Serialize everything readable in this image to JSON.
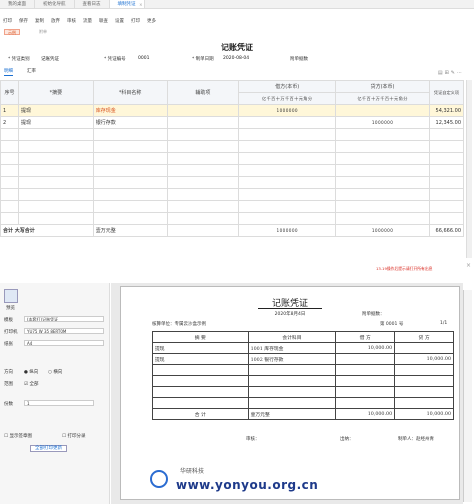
{
  "tabs": [
    {
      "label": "我的桌面"
    },
    {
      "label": "初始化导航"
    },
    {
      "label": "查看日志"
    },
    {
      "label": "填制凭证",
      "active": true
    }
  ],
  "toolbar": [
    "打印",
    "保存",
    "复制",
    "放弃",
    "",
    "审核",
    "流量",
    "联查",
    "设置",
    "打印",
    "更多"
  ],
  "badges": {
    "sample": "示例",
    "draft": "附单"
  },
  "voucher": {
    "title": "记账凭证",
    "word_label": "* 凭证类别",
    "word_value": "记账凭证",
    "no_label": "* 凭证编号",
    "no_value": "0001",
    "date_label": "* 制单日期",
    "date_value": "2020-08-04",
    "attach_label": "附单据数"
  },
  "subtabs": [
    "明细",
    "汇率"
  ],
  "table": {
    "headers": {
      "seq": "序号",
      "summary": "*摘要",
      "account": "*科目名称",
      "aux": "辅助项",
      "debit": "借方(本币)",
      "credit": "贷方(本币)",
      "custom": "凭证自定义项"
    },
    "digits": "亿千百十万千百十元角分",
    "rows": [
      {
        "seq": "1",
        "summary": "提现",
        "account": "库存现金",
        "debit_digits": "1000000",
        "credit_digits": "",
        "custom": "54,321.00"
      },
      {
        "seq": "2",
        "summary": "提现",
        "account": "银行存款",
        "debit_digits": "",
        "credit_digits": "1000000",
        "custom": "12,345.00"
      }
    ],
    "total": {
      "label": "合计 大写合计",
      "amount_words": "壹万元整",
      "debit_digits": "1000000",
      "credit_digits": "1000000",
      "custom": "66,666.00"
    }
  },
  "error_msg": "13.19操作后提示请打开所有出息",
  "print": {
    "left": {
      "preview_label": "预览",
      "template_label": "模板",
      "template_value": "(本套打)记账凭证",
      "printer_label": "打印机",
      "printer_value": "YU75 W 35 8ERT0M",
      "paper_label": "纸张",
      "paper_value": "A4",
      "direction_label": "方向",
      "direction_portrait": "纵向",
      "direction_landscape": "横向",
      "copies_label": "份数",
      "copies_value": "1",
      "range_label": "范围",
      "range_all": "全部",
      "check1": "显示签章图",
      "check2": "打印分录",
      "btn_label": "全部打印更新"
    },
    "paper": {
      "title": "记账凭证",
      "date": "2020年8月4日",
      "unit": "核算单位：专属云沙盒示例",
      "attach": "附单据数：",
      "no": "第 0001 号",
      "page": "1/1",
      "cols": [
        "摘  要",
        "会计科目",
        "借  方",
        "贷  方"
      ],
      "rows": [
        {
          "summary": "提现",
          "account": "1001 库存现金",
          "debit": "10,000.00",
          "credit": ""
        },
        {
          "summary": "提现",
          "account": "1002 银行存款",
          "debit": "",
          "credit": "10,000.00"
        }
      ],
      "total_label": "合    计",
      "total_words": "壹万元整",
      "total_debit": "10,000.00",
      "total_credit": "10,000.00",
      "footer_maker": "制单人：赵经州青",
      "footer_keep": "审核：",
      "footer_post": "出纳："
    }
  },
  "watermark": "www.yonyou.org.cn",
  "watermark_cn": "华研科技"
}
